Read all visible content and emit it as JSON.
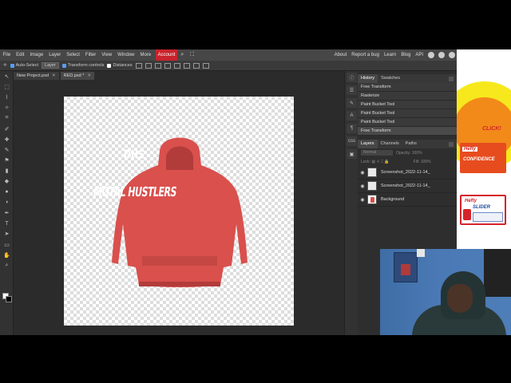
{
  "menubar": {
    "items": [
      "File",
      "Edit",
      "Image",
      "Layer",
      "Select",
      "Filter",
      "View",
      "Window",
      "More"
    ],
    "account": "Account",
    "right_links": [
      "About",
      "Report a bug",
      "Learn",
      "Blog",
      "API"
    ]
  },
  "options": {
    "auto_select": "Auto-Select",
    "select_target": "Layer",
    "transform_controls": "Transform controls",
    "distances": "Distances"
  },
  "tabs": [
    {
      "label": "New Project.psd"
    },
    {
      "label": "RED.psd *"
    }
  ],
  "canvas": {
    "hood_text": "DHS",
    "front_text": "MOTAL HUSTLERS",
    "colors": {
      "hoodie": "#d9504d",
      "hoodie_dark": "#b23c3a",
      "text": "#ffffff"
    }
  },
  "history": {
    "tabs": [
      "History",
      "Swatches"
    ],
    "items": [
      "Free Transform",
      "Rasterize",
      "Paint Bucket Tool",
      "Paint Bucket Tool",
      "Paint Bucket Tool",
      "Free Transform"
    ]
  },
  "layers": {
    "tabs": [
      "Layers",
      "Channels",
      "Paths"
    ],
    "blend_mode": "Normal",
    "opacity_label": "Opacity:",
    "opacity_value": "100%",
    "lock_label": "Lock:",
    "fill_label": "Fill:",
    "fill_value": "100%",
    "items": [
      {
        "name": "Screenshot_2022-11-14_"
      },
      {
        "name": "Screenshot_2022-11-14_"
      },
      {
        "name": "Background"
      }
    ]
  },
  "ad": {
    "click": "CLICK!",
    "product1_brand": "Hefty",
    "product1_name": "CONFIDENCE",
    "product2_brand": "Hefty",
    "product2_name": "SLIDER"
  },
  "accent": "#c8232c"
}
